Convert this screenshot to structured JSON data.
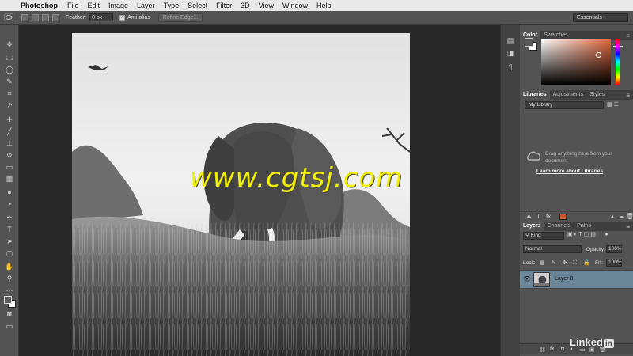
{
  "menubar": {
    "apple": "",
    "items": [
      "Photoshop",
      "File",
      "Edit",
      "Image",
      "Layer",
      "Type",
      "Select",
      "Filter",
      "3D",
      "View",
      "Window",
      "Help"
    ]
  },
  "options": {
    "feather_label": "Feather:",
    "feather_value": "0 px",
    "antialias_label": "Anti-alias",
    "antialias_checked": true,
    "refine_edge_label": "Refine Edge...",
    "workspace": "Essentials"
  },
  "watermark": "www.cgtsj.com",
  "color_panel": {
    "tabs": [
      "Color",
      "Swatches"
    ],
    "foreground": "#5a5a5a",
    "background": "#ffffff",
    "picker_hue": "#e0663a"
  },
  "libraries_panel": {
    "tabs": [
      "Libraries",
      "Adjustments",
      "Styles"
    ],
    "library_select": "My Library",
    "empty_message": "Drag anything here from your document",
    "learn_more": "Learn more about Libraries",
    "swatch_color": "#c8582a"
  },
  "layers_panel": {
    "tabs": [
      "Layers",
      "Channels",
      "Paths"
    ],
    "kind_label": "Kind",
    "blend_mode": "Normal",
    "opacity_label": "Opacity:",
    "opacity_value": "100%",
    "lock_label": "Lock:",
    "fill_label": "Fill:",
    "fill_value": "100%",
    "layers": [
      {
        "name": "Layer 0",
        "visible": true,
        "selected": true
      }
    ]
  },
  "branding": {
    "text": "Linked",
    "badge": "in"
  }
}
